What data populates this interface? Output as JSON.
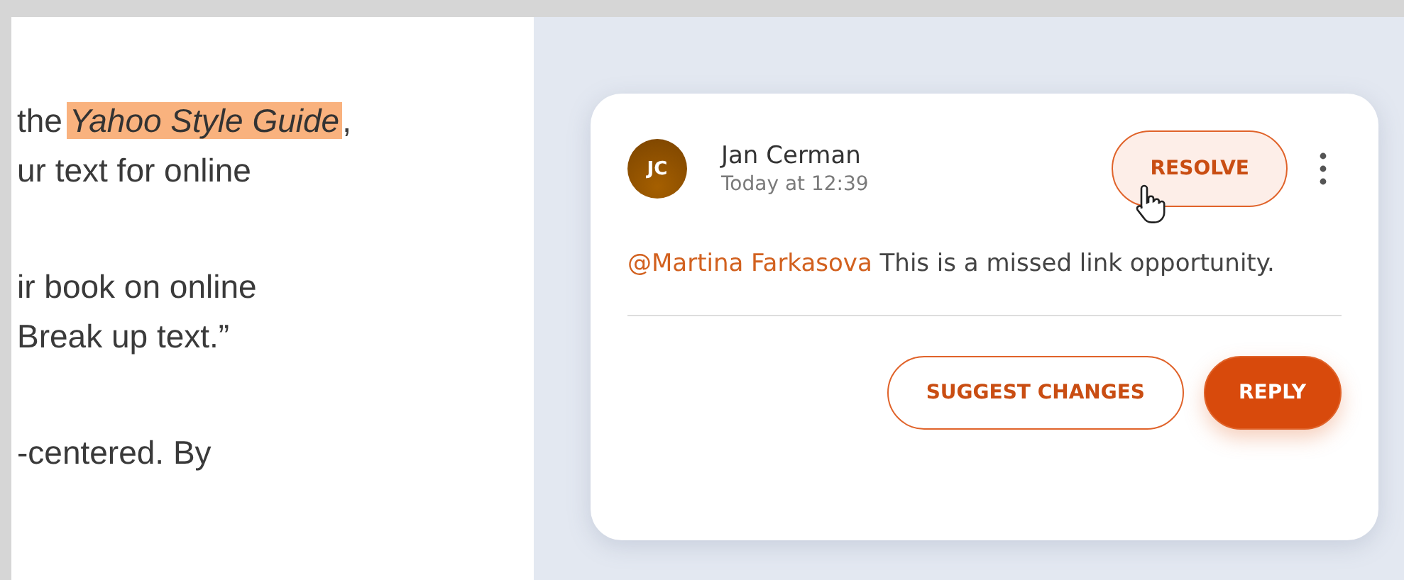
{
  "document": {
    "paragraphs": [
      {
        "lines": [
          {
            "before": "the",
            "highlight": "Yahoo Style Guide",
            "after": ","
          },
          {
            "before": "ur text for online"
          }
        ]
      },
      {
        "lines": [
          {
            "before": "ir book on online"
          },
          {
            "before": "Break up text.”"
          }
        ]
      },
      {
        "lines": [
          {
            "before": "-centered. By"
          }
        ]
      }
    ]
  },
  "comment": {
    "avatar_initials": "JC",
    "author": "Jan Cerman",
    "time": "Today at 12:39",
    "resolve_label": "RESOLVE",
    "mention": "@Martina Farkasova",
    "body": "This is a missed link opportunity.",
    "suggest_label": "SUGGEST CHANGES",
    "reply_label": "REPLY"
  }
}
